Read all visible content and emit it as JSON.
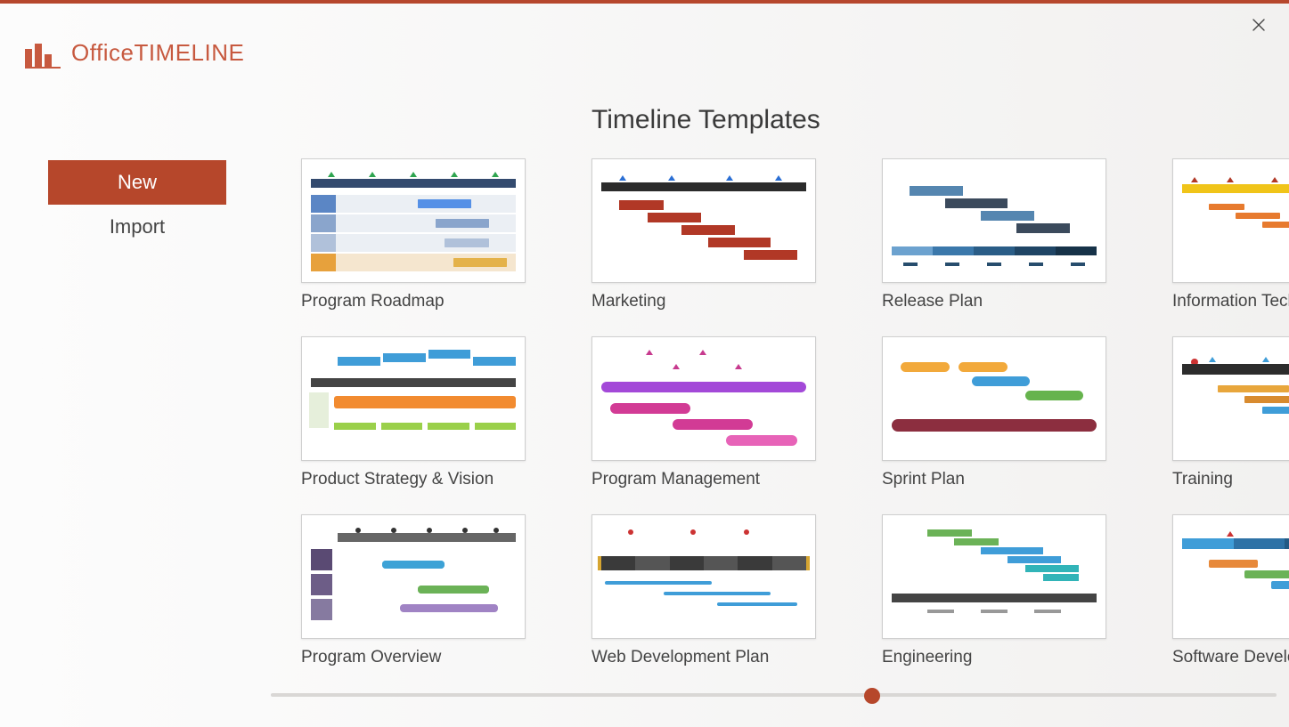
{
  "app": {
    "brand_1": "Office",
    "brand_2": "TIMELINE"
  },
  "sidebar": {
    "items": [
      {
        "label": "New",
        "active": true
      },
      {
        "label": "Import",
        "active": false
      }
    ]
  },
  "content": {
    "section_title": "Timeline Templates",
    "templates": [
      {
        "label": "Program Roadmap"
      },
      {
        "label": "Marketing"
      },
      {
        "label": "Release Plan"
      },
      {
        "label": "Information Technology"
      },
      {
        "label": "Product Strategy & Vision"
      },
      {
        "label": "Program Management"
      },
      {
        "label": "Sprint Plan"
      },
      {
        "label": "Training"
      },
      {
        "label": "Program Overview"
      },
      {
        "label": "Web Development Plan"
      },
      {
        "label": "Engineering"
      },
      {
        "label": "Software Development"
      }
    ]
  },
  "colors": {
    "accent": "#b6472b"
  }
}
